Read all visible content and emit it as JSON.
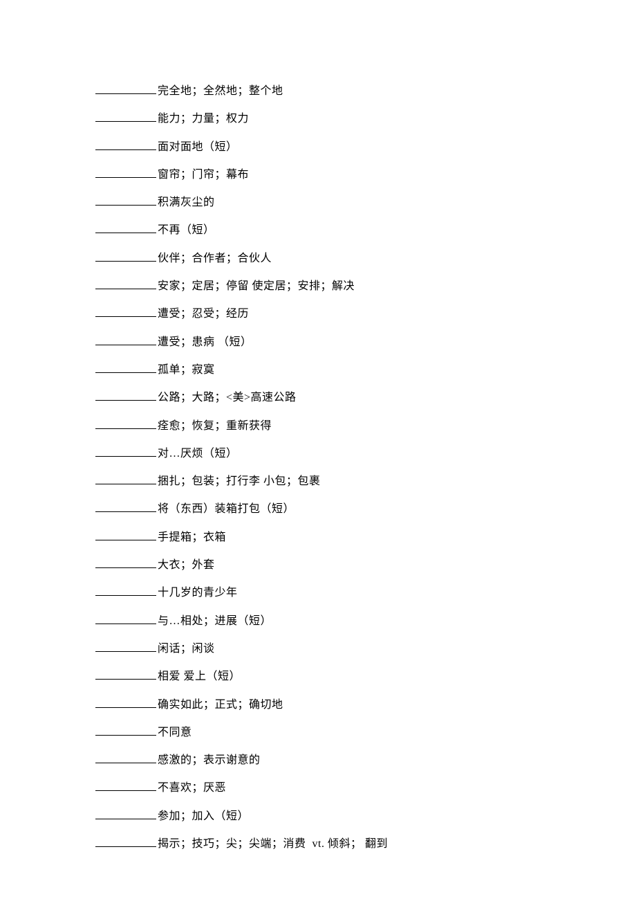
{
  "items": [
    {
      "text": "完全地；全然地；整个地"
    },
    {
      "text": "能力；力量；权力"
    },
    {
      "text": "面对面地（短）"
    },
    {
      "text": "窗帘；门帘；幕布"
    },
    {
      "text": "积满灰尘的"
    },
    {
      "text": "不再（短）"
    },
    {
      "text": "伙伴；合作者；合伙人"
    },
    {
      "text": "安家；定居；停留 使定居；安排；解决"
    },
    {
      "text": "遭受；忍受；经历"
    },
    {
      "text": "遭受；患病 （短）"
    },
    {
      "text": "孤单；寂寞"
    },
    {
      "text": "公路；大路；<美>高速公路"
    },
    {
      "text": "痊愈；恢复；重新获得"
    },
    {
      "text": "对…厌烦（短）"
    },
    {
      "text": "捆扎；包装；打行李 小包；包裹"
    },
    {
      "text": "将（东西）装箱打包（短）"
    },
    {
      "text": "手提箱；衣箱"
    },
    {
      "text": "大衣；外套"
    },
    {
      "text": "十几岁的青少年"
    },
    {
      "text": "与…相处；进展（短）"
    },
    {
      "text": "闲话；闲谈"
    },
    {
      "text": "相爱 爱上（短）"
    },
    {
      "text": "确实如此；正式；确切地"
    },
    {
      "text": "不同意"
    },
    {
      "text": "感激的；表示谢意的"
    },
    {
      "text": "不喜欢；厌恶"
    },
    {
      "text": "参加；加入（短）"
    },
    {
      "text": "揭示；技巧；尖；尖端；消费  vt. 倾斜； 翻到"
    }
  ]
}
